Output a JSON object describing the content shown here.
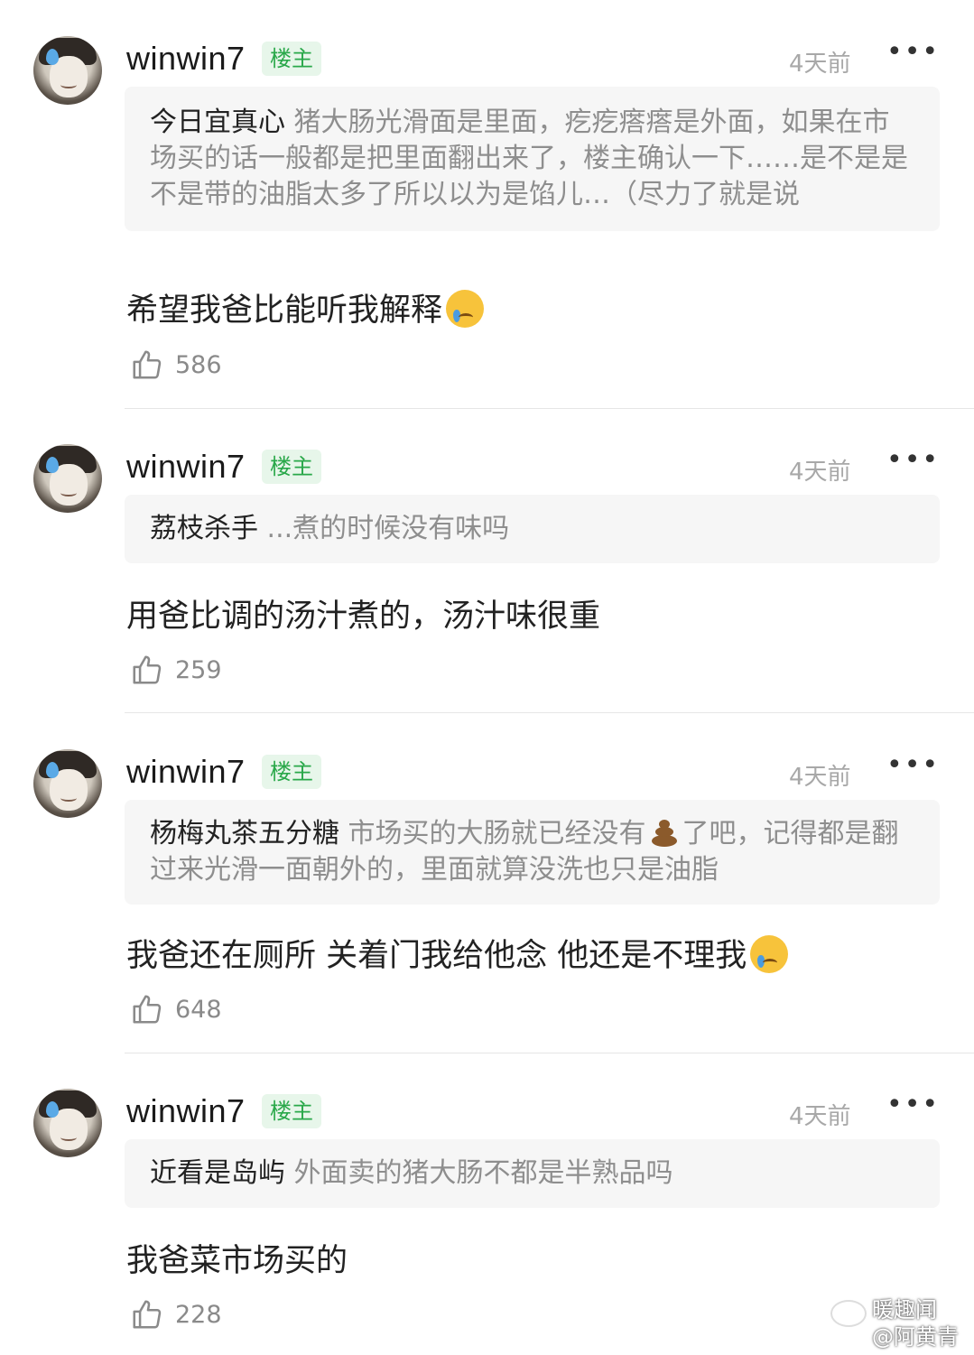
{
  "comments": [
    {
      "username": "winwin7",
      "badge": "楼主",
      "time": "4天前",
      "more": "•••",
      "quote_name": "今日宜真心",
      "quote_text": " 猪大肠光滑面是里面，疙疙瘩瘩是外面，如果在市场买的话一般都是把里面翻出来了，楼主确认一下……是不是是不是带的油脂太多了所以以为是馅儿…（尽力了就是说",
      "reply": "希望我爸比能听我解释",
      "likes": "586"
    },
    {
      "username": "winwin7",
      "badge": "楼主",
      "time": "4天前",
      "more": "•••",
      "quote_name": "荔枝杀手",
      "quote_text": " ...煮的时候没有味吗",
      "reply": "用爸比调的汤汁煮的，汤汁味很重",
      "likes": "259"
    },
    {
      "username": "winwin7",
      "badge": "楼主",
      "time": "4天前",
      "more": "•••",
      "quote_name": "杨梅丸茶五分糖",
      "quote_text_a": " 市场买的大肠就已经没有",
      "quote_text_b": "了吧，记得都是翻过来光滑一面朝外的，里面就算没洗也只是油脂",
      "reply": "我爸还在厕所 关着门我给他念 他还是不理我",
      "likes": "648"
    },
    {
      "username": "winwin7",
      "badge": "楼主",
      "time": "4天前",
      "more": "•••",
      "quote_name": "近看是岛屿",
      "quote_text": " 外面卖的猪大肠不都是半熟品吗",
      "reply": "我爸菜市场买的",
      "likes": "228"
    }
  ],
  "watermark": {
    "line1": "暖趣闻",
    "line2": "@阿黄青"
  },
  "colors": {
    "badge_bg": "#e7f6ea",
    "badge_text": "#2aa84a",
    "quote_bg": "#f6f6f6",
    "muted_text": "#8e8e8e"
  },
  "icons": [
    "avatar",
    "more-icon",
    "thumbs-up-icon",
    "crying-emoji-icon",
    "poop-emoji-icon",
    "weibo-icon"
  ]
}
